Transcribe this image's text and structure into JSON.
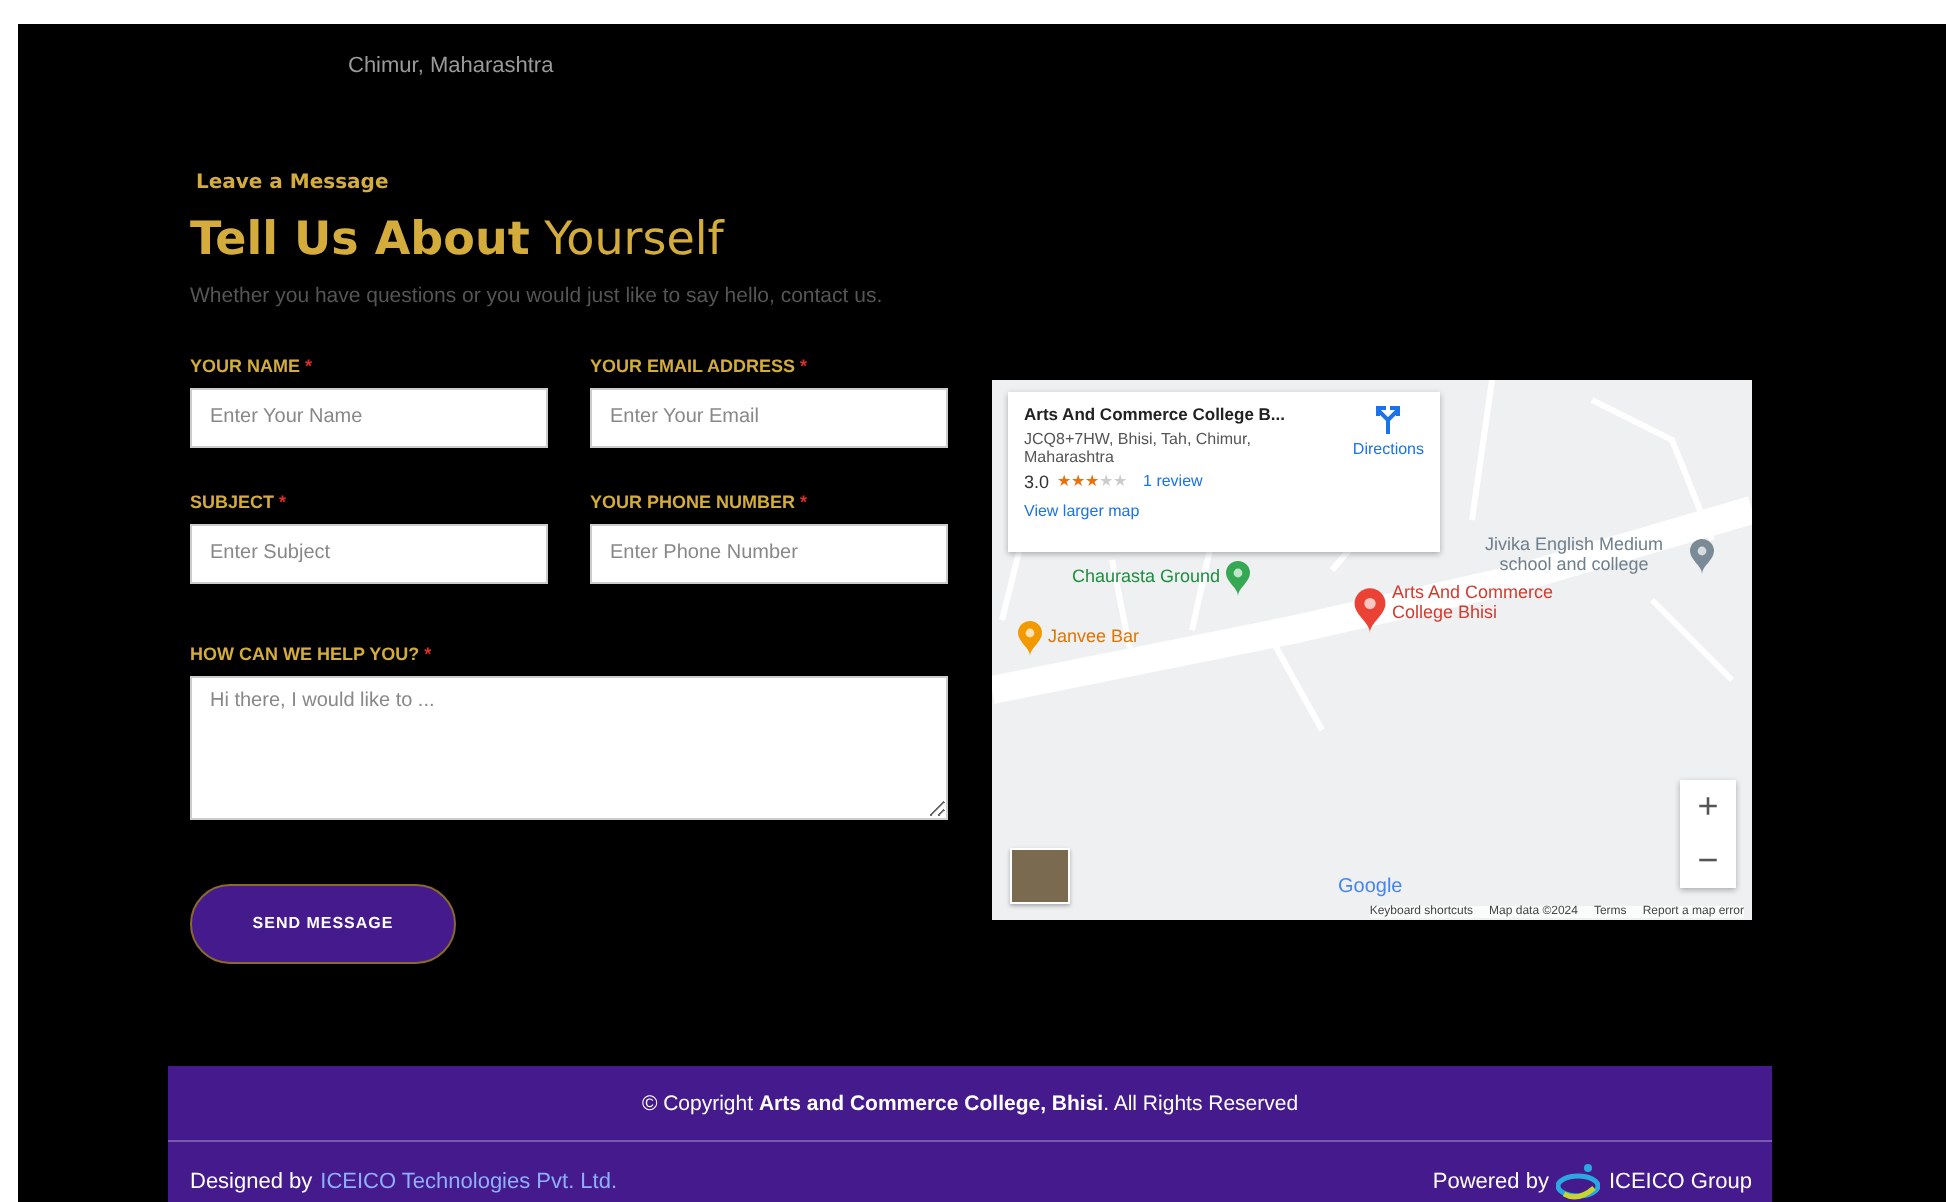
{
  "address_tail": "Chimur, Maharashtra",
  "form": {
    "eyebrow": "Leave a Message",
    "title": "**Tell Us About** Yourself",
    "intro": "Whether you have questions or you would just like to say hello, contact us.",
    "fields": [
      {
        "label": "YOUR NAME",
        "required": true,
        "placeholder": "Enter Your Name"
      },
      {
        "label": "YOUR EMAIL ADDRESS",
        "required": true,
        "placeholder": "Enter Your Email"
      },
      {
        "label": "SUBJECT",
        "required": true,
        "placeholder": "Enter Subject"
      },
      {
        "label": "YOUR PHONE NUMBER",
        "required": true,
        "placeholder": "Enter Phone Number"
      }
    ],
    "message": {
      "label": "HOW CAN WE HELP YOU?",
      "required": true,
      "placeholder": "Hi there, I would like to ..."
    },
    "required_mark": "*",
    "submit": "SEND MESSAGE"
  },
  "map": {
    "card": {
      "name": "Arts And Commerce College B...",
      "address": "JCQ8+7HW, Bhisi, Tah, Chimur, Maharashtra",
      "rating": "3.0",
      "stars": 3,
      "reviews": "1 review",
      "directions": "Directions",
      "larger": "View larger map"
    },
    "places": [
      {
        "kind": "green",
        "name": "Chaurasta Ground"
      },
      {
        "kind": "orange",
        "name": "Janvee Bar"
      },
      {
        "kind": "red",
        "name": "Arts And Commerce College Bhisi"
      },
      {
        "kind": "grey",
        "name": "Jivika English Medium school and college"
      }
    ],
    "zoom": [
      "+",
      "−"
    ],
    "logo": "Google",
    "attribution": [
      "Keyboard shortcuts",
      "Map data ©2024",
      "Terms",
      "Report a map error"
    ]
  },
  "footer": {
    "copyright": "© Copyright **Arts and Commerce College, Bhisi**. All Rights Reserved",
    "designed_by": "Designed by",
    "designer": "ICEICO Technologies Pvt. Ltd.",
    "powered_by": "Powered by",
    "group": "ICEICO Group"
  }
}
